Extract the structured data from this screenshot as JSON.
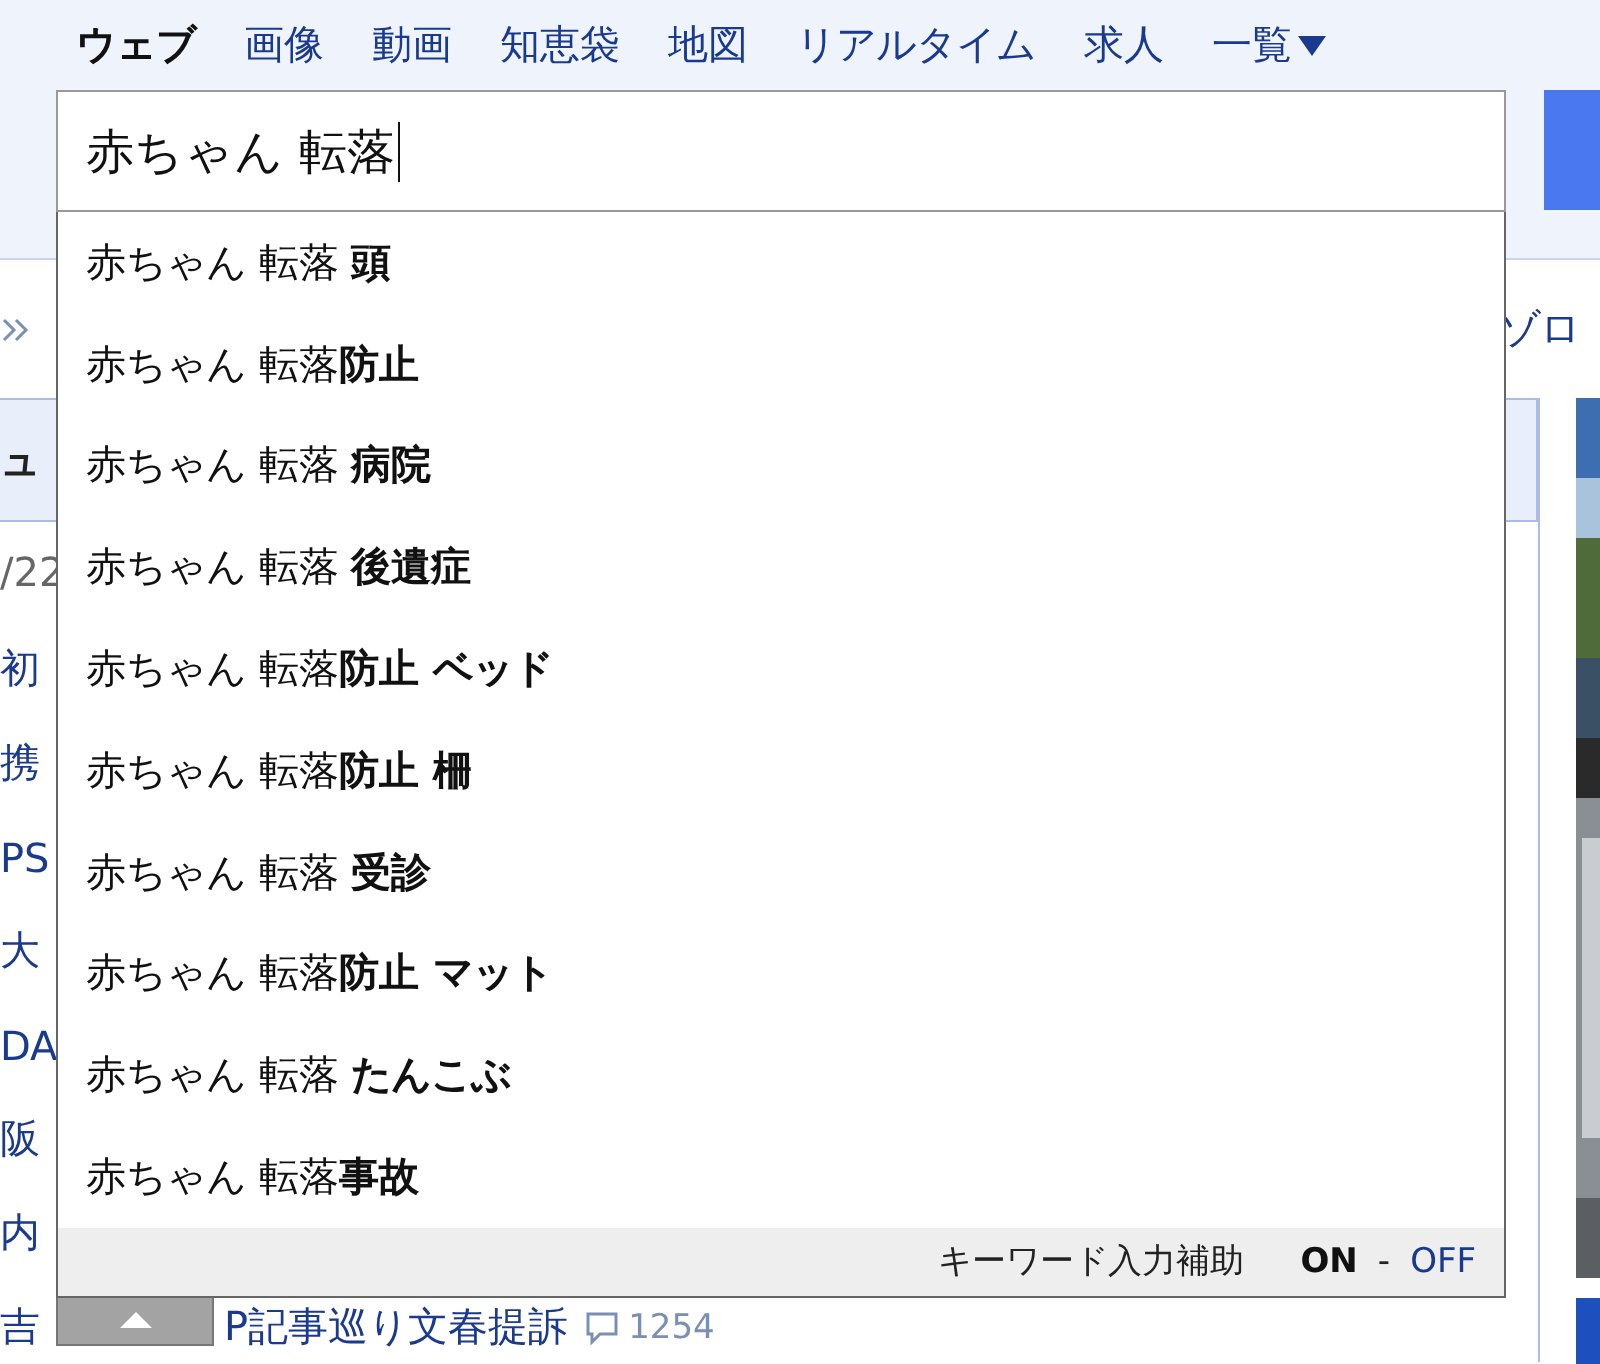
{
  "nav": {
    "tabs": [
      {
        "label": "ウェブ",
        "selected": true,
        "kind": "link"
      },
      {
        "label": "画像",
        "selected": false,
        "kind": "link"
      },
      {
        "label": "動画",
        "selected": false,
        "kind": "link"
      },
      {
        "label": "知恵袋",
        "selected": false,
        "kind": "link"
      },
      {
        "label": "地図",
        "selected": false,
        "kind": "link"
      },
      {
        "label": "リアルタイム",
        "selected": false,
        "kind": "link"
      },
      {
        "label": "求人",
        "selected": false,
        "kind": "link"
      },
      {
        "label": "一覧",
        "selected": false,
        "kind": "menu"
      }
    ]
  },
  "search": {
    "value": "赤ちゃん 転落"
  },
  "suggestions": [
    "赤ちゃん 転落 **頭**",
    "赤ちゃん 転落**防止**",
    "赤ちゃん 転落 **病院**",
    "赤ちゃん 転落 **後遺症**",
    "赤ちゃん 転落**防止 ベッド**",
    "赤ちゃん 転落**防止 柵**",
    "赤ちゃん 転落 **受診**",
    "赤ちゃん 転落**防止 マット**",
    "赤ちゃん 転落 **たんこぶ**",
    "赤ちゃん 転落**事故**"
  ],
  "assist": {
    "label": "キーワード入力補助",
    "separator": "-",
    "options": [
      {
        "label": "ON",
        "selected": true
      },
      {
        "label": "OFF",
        "selected": false
      }
    ]
  },
  "background": {
    "top_right": "ゾロ",
    "section_title": "ュ",
    "news": [
      {
        "text": "/22",
        "kind": "date"
      },
      {
        "text": "初",
        "kind": "link"
      },
      {
        "text": "携",
        "kind": "link"
      },
      {
        "text": "PS",
        "kind": "link"
      },
      {
        "text": "大",
        "kind": "link"
      },
      {
        "text": "DA",
        "kind": "link"
      },
      {
        "text": "阪",
        "kind": "link"
      },
      {
        "text": "内",
        "kind": "link"
      },
      {
        "text": "吉",
        "kind": "link",
        "tail": "P記事巡り文春提訴",
        "comments": "1254"
      }
    ]
  }
}
